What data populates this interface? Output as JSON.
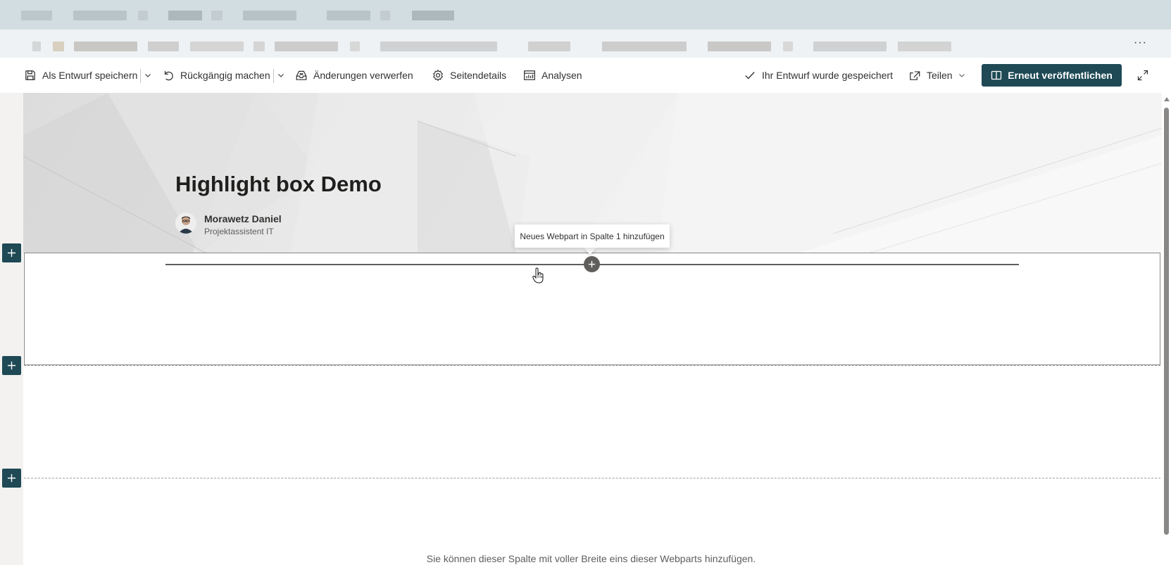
{
  "toolbar": {
    "save_draft": "Als Entwurf speichern",
    "undo": "Rückgängig machen",
    "discard": "Änderungen verwerfen",
    "page_details": "Seitendetails",
    "analytics": "Analysen",
    "draft_status": "Ihr Entwurf wurde gespeichert",
    "share": "Teilen",
    "republish": "Erneut veröffentlichen",
    "more": "···"
  },
  "hero": {
    "title": "Highlight box Demo",
    "author_name": "Morawetz Daniel",
    "author_role": "Projektassistent IT"
  },
  "tooltip": {
    "text": "Neues Webpart in Spalte 1 hinzufügen"
  },
  "canvas": {
    "hint": "Sie können dieser Spalte mit voller Breite eins dieser Webparts hinzufügen."
  },
  "colors": {
    "accent": "#1e4955",
    "text": "#323130",
    "subtle": "#605e5c"
  }
}
